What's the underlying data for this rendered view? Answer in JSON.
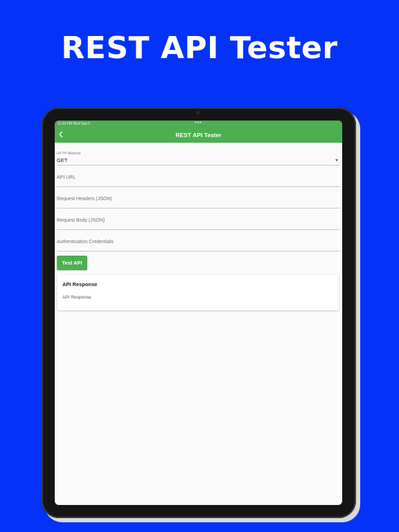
{
  "promo": {
    "title": "REST API Tester"
  },
  "device": {
    "status_time": "11:53 PM   Wed Sep 6",
    "status_dots": "•••"
  },
  "appbar": {
    "title": "REST API Tester",
    "back_icon": "chevron-left-icon"
  },
  "form": {
    "method": {
      "label": "HTTP Method",
      "value": "GET",
      "icon": "dropdown-arrow-icon"
    },
    "url": {
      "placeholder": "API URL"
    },
    "headers": {
      "placeholder": "Request Headers (JSON)"
    },
    "body": {
      "placeholder": "Request Body (JSON)"
    },
    "auth": {
      "placeholder": "Authentication Credentials"
    },
    "test_button_label": "Test API"
  },
  "response": {
    "title": "API Response",
    "body": "API Response"
  },
  "colors": {
    "background": "#0433f7",
    "accent": "#4caf50",
    "screen": "#fafafa"
  }
}
